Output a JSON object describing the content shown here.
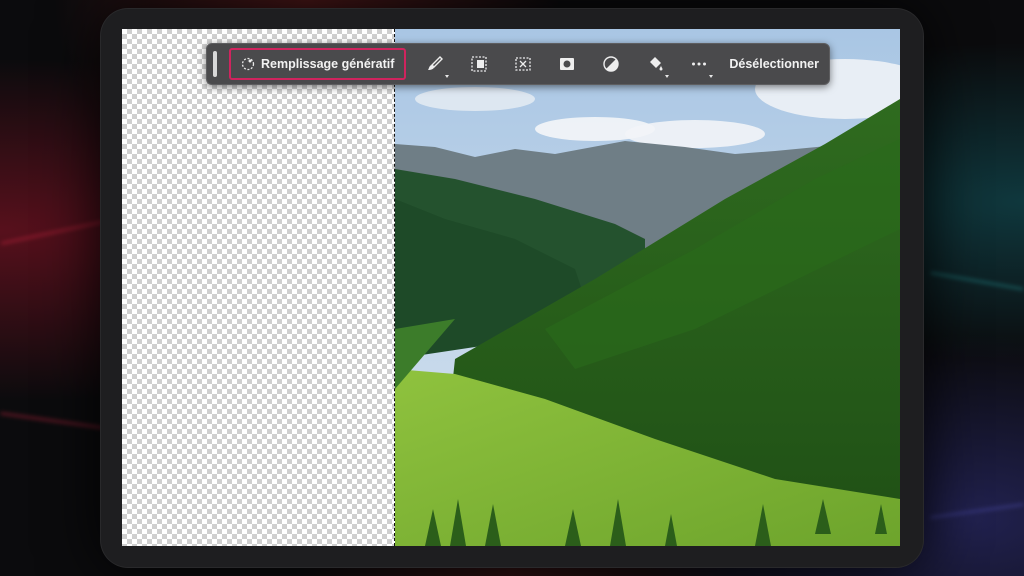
{
  "toolbar": {
    "generative_fill_label": "Remplissage génératif",
    "deselect_label": "Désélectionner",
    "tools": [
      {
        "icon": "brush-icon",
        "has_menu": true
      },
      {
        "icon": "transform-selection-icon",
        "has_menu": false
      },
      {
        "icon": "crop-selection-icon",
        "has_menu": false
      },
      {
        "icon": "mask-icon",
        "has_menu": false
      },
      {
        "icon": "adjustment-icon",
        "has_menu": false
      },
      {
        "icon": "fill-bucket-icon",
        "has_menu": true
      },
      {
        "icon": "more-options-icon",
        "has_menu": true
      }
    ]
  },
  "colors": {
    "highlight_border": "#d0245e",
    "toolbar_bg": "#4a4a4c"
  }
}
